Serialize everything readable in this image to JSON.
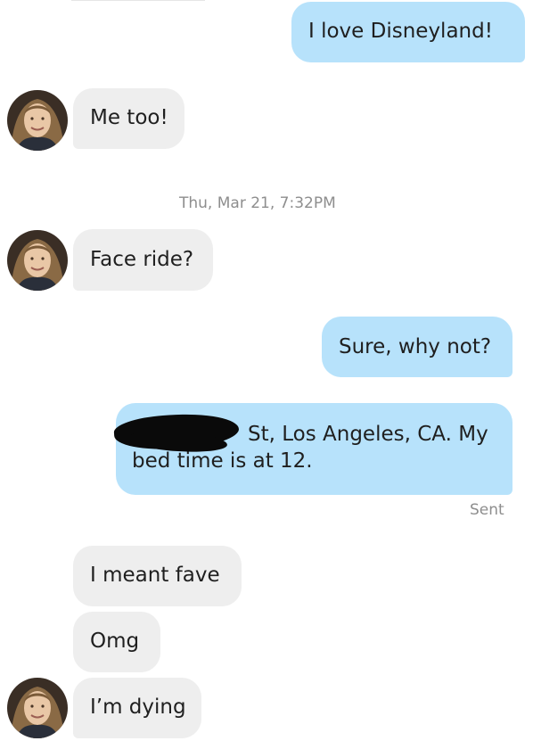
{
  "conversation": {
    "messages": [
      {
        "id": "m1",
        "sender": "self",
        "text": "I love Disneyland!"
      },
      {
        "id": "m2",
        "sender": "match",
        "text": "Me too!"
      },
      {
        "id": "m3",
        "sender": "match",
        "text": "Face ride?"
      },
      {
        "id": "m4",
        "sender": "self",
        "text": "Sure, why not?"
      },
      {
        "id": "m5",
        "sender": "self",
        "line1": "St, Los Angeles, CA. My",
        "line2": "bed time is at 12."
      },
      {
        "id": "m6",
        "sender": "match",
        "text": "I meant fave"
      },
      {
        "id": "m7",
        "sender": "match",
        "text": "Omg"
      },
      {
        "id": "m8",
        "sender": "match",
        "text": "I’m dying"
      }
    ],
    "timestamp": "Thu, Mar 21, 7:32PM",
    "sent_status": "Sent"
  },
  "colors": {
    "outgoing_bubble": "#b7e2fb",
    "incoming_bubble": "#eeeeee",
    "meta_text": "#8e8e8e"
  }
}
